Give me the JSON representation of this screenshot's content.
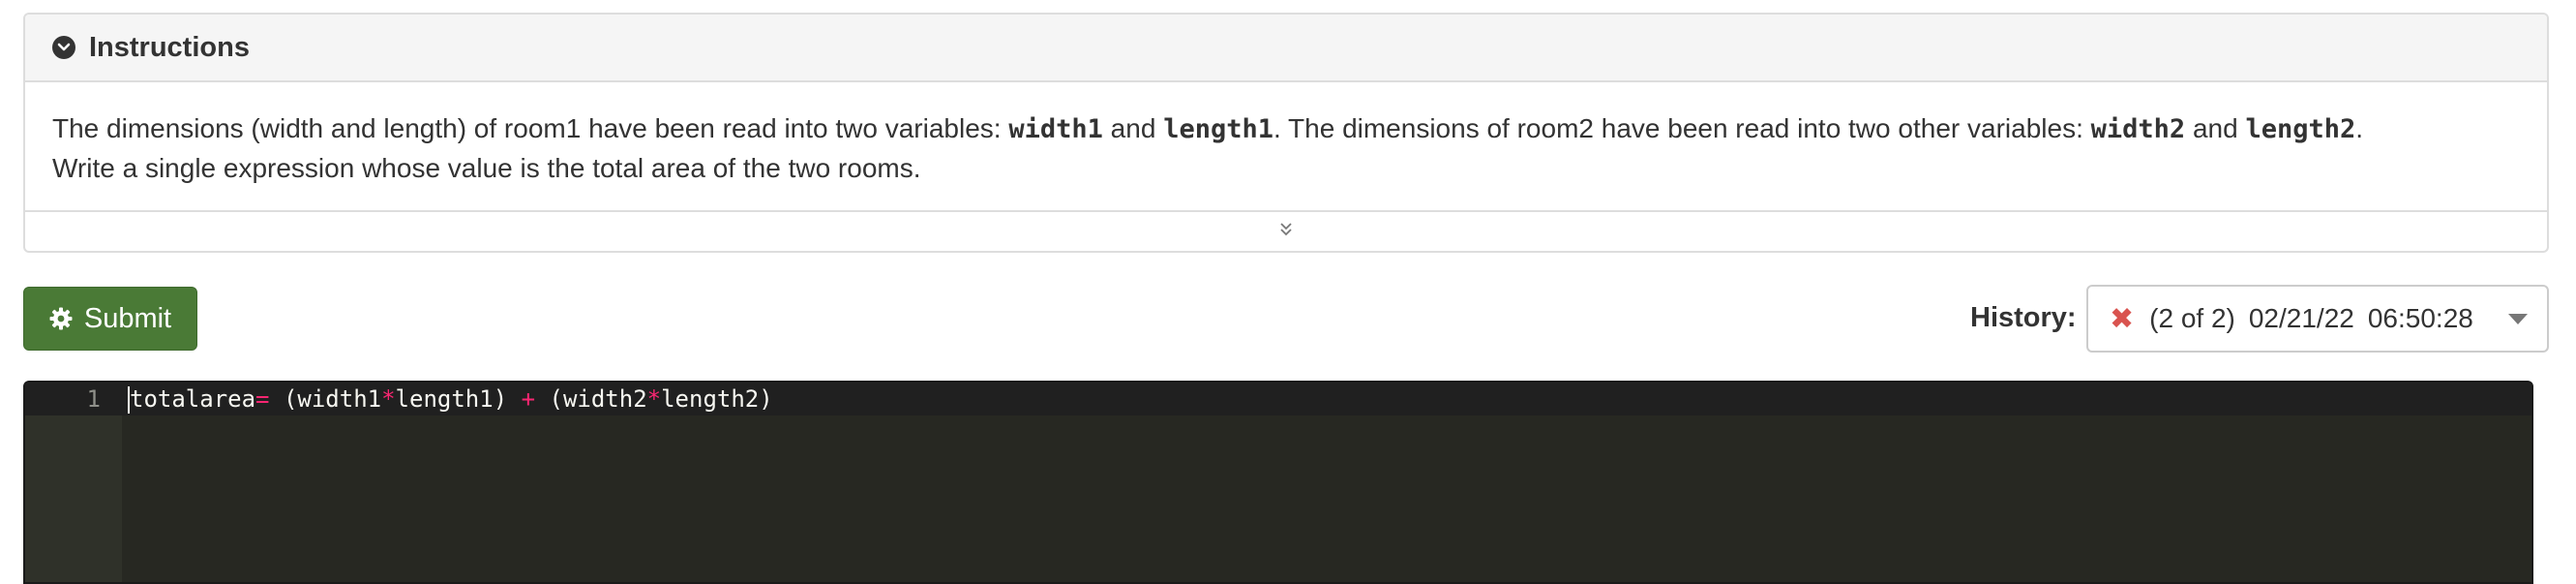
{
  "instructions": {
    "title": "Instructions",
    "text_1": "The dimensions (width and length) of room1 have been read into two ",
    "word_variables_1": "variables",
    "text_2": ": ",
    "var_width1": "width1",
    "text_and_1": " and ",
    "var_length1": "length1",
    "text_3": ". The dimensions of room2 have been read into two other ",
    "word_variables_2": "variables",
    "text_4": ": ",
    "var_width2": "width2",
    "text_and_2": " and ",
    "var_length2": "length2",
    "text_5": ".",
    "text_6": "Write a single expression whose value is the total area of the two rooms."
  },
  "submit": {
    "label": "Submit"
  },
  "history": {
    "label": "History:",
    "status_icon": "x-icon",
    "selected_index": "(2 of 2)",
    "date": "02/21/22",
    "time": "06:50:28"
  },
  "editor": {
    "line_number": "1",
    "tokens": {
      "t1": "totalarea",
      "t2": "=",
      "t3": " (width1",
      "t4": "*",
      "t5": "length1) ",
      "t6": "+",
      "t7": " (width2",
      "t8": "*",
      "t9": "length2)"
    }
  },
  "colors": {
    "submit_bg": "#4a7a36",
    "editor_bg": "#272822",
    "operator": "#f92672",
    "error_x": "#d9534f"
  }
}
